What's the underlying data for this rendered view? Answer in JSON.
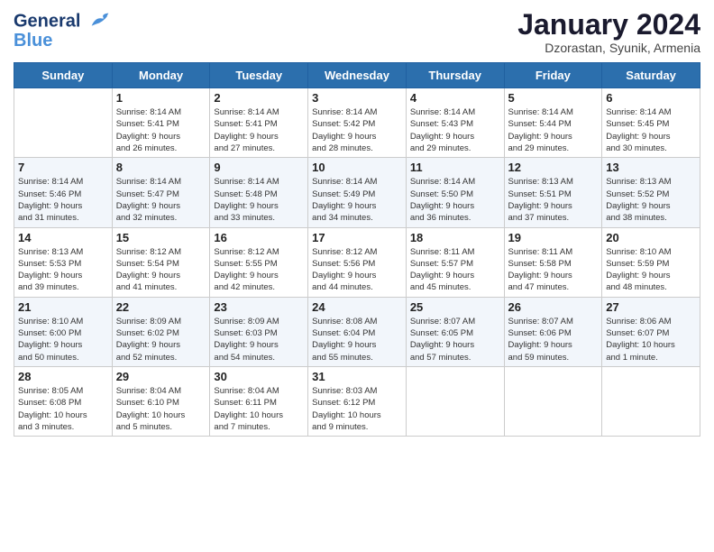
{
  "header": {
    "logo_line1": "General",
    "logo_line2": "Blue",
    "month_year": "January 2024",
    "location": "Dzorastan, Syunik, Armenia"
  },
  "days_of_week": [
    "Sunday",
    "Monday",
    "Tuesday",
    "Wednesday",
    "Thursday",
    "Friday",
    "Saturday"
  ],
  "weeks": [
    [
      {
        "day": "",
        "content": ""
      },
      {
        "day": "1",
        "content": "Sunrise: 8:14 AM\nSunset: 5:41 PM\nDaylight: 9 hours\nand 26 minutes."
      },
      {
        "day": "2",
        "content": "Sunrise: 8:14 AM\nSunset: 5:41 PM\nDaylight: 9 hours\nand 27 minutes."
      },
      {
        "day": "3",
        "content": "Sunrise: 8:14 AM\nSunset: 5:42 PM\nDaylight: 9 hours\nand 28 minutes."
      },
      {
        "day": "4",
        "content": "Sunrise: 8:14 AM\nSunset: 5:43 PM\nDaylight: 9 hours\nand 29 minutes."
      },
      {
        "day": "5",
        "content": "Sunrise: 8:14 AM\nSunset: 5:44 PM\nDaylight: 9 hours\nand 29 minutes."
      },
      {
        "day": "6",
        "content": "Sunrise: 8:14 AM\nSunset: 5:45 PM\nDaylight: 9 hours\nand 30 minutes."
      }
    ],
    [
      {
        "day": "7",
        "content": "Sunrise: 8:14 AM\nSunset: 5:46 PM\nDaylight: 9 hours\nand 31 minutes."
      },
      {
        "day": "8",
        "content": "Sunrise: 8:14 AM\nSunset: 5:47 PM\nDaylight: 9 hours\nand 32 minutes."
      },
      {
        "day": "9",
        "content": "Sunrise: 8:14 AM\nSunset: 5:48 PM\nDaylight: 9 hours\nand 33 minutes."
      },
      {
        "day": "10",
        "content": "Sunrise: 8:14 AM\nSunset: 5:49 PM\nDaylight: 9 hours\nand 34 minutes."
      },
      {
        "day": "11",
        "content": "Sunrise: 8:14 AM\nSunset: 5:50 PM\nDaylight: 9 hours\nand 36 minutes."
      },
      {
        "day": "12",
        "content": "Sunrise: 8:13 AM\nSunset: 5:51 PM\nDaylight: 9 hours\nand 37 minutes."
      },
      {
        "day": "13",
        "content": "Sunrise: 8:13 AM\nSunset: 5:52 PM\nDaylight: 9 hours\nand 38 minutes."
      }
    ],
    [
      {
        "day": "14",
        "content": "Sunrise: 8:13 AM\nSunset: 5:53 PM\nDaylight: 9 hours\nand 39 minutes."
      },
      {
        "day": "15",
        "content": "Sunrise: 8:12 AM\nSunset: 5:54 PM\nDaylight: 9 hours\nand 41 minutes."
      },
      {
        "day": "16",
        "content": "Sunrise: 8:12 AM\nSunset: 5:55 PM\nDaylight: 9 hours\nand 42 minutes."
      },
      {
        "day": "17",
        "content": "Sunrise: 8:12 AM\nSunset: 5:56 PM\nDaylight: 9 hours\nand 44 minutes."
      },
      {
        "day": "18",
        "content": "Sunrise: 8:11 AM\nSunset: 5:57 PM\nDaylight: 9 hours\nand 45 minutes."
      },
      {
        "day": "19",
        "content": "Sunrise: 8:11 AM\nSunset: 5:58 PM\nDaylight: 9 hours\nand 47 minutes."
      },
      {
        "day": "20",
        "content": "Sunrise: 8:10 AM\nSunset: 5:59 PM\nDaylight: 9 hours\nand 48 minutes."
      }
    ],
    [
      {
        "day": "21",
        "content": "Sunrise: 8:10 AM\nSunset: 6:00 PM\nDaylight: 9 hours\nand 50 minutes."
      },
      {
        "day": "22",
        "content": "Sunrise: 8:09 AM\nSunset: 6:02 PM\nDaylight: 9 hours\nand 52 minutes."
      },
      {
        "day": "23",
        "content": "Sunrise: 8:09 AM\nSunset: 6:03 PM\nDaylight: 9 hours\nand 54 minutes."
      },
      {
        "day": "24",
        "content": "Sunrise: 8:08 AM\nSunset: 6:04 PM\nDaylight: 9 hours\nand 55 minutes."
      },
      {
        "day": "25",
        "content": "Sunrise: 8:07 AM\nSunset: 6:05 PM\nDaylight: 9 hours\nand 57 minutes."
      },
      {
        "day": "26",
        "content": "Sunrise: 8:07 AM\nSunset: 6:06 PM\nDaylight: 9 hours\nand 59 minutes."
      },
      {
        "day": "27",
        "content": "Sunrise: 8:06 AM\nSunset: 6:07 PM\nDaylight: 10 hours\nand 1 minute."
      }
    ],
    [
      {
        "day": "28",
        "content": "Sunrise: 8:05 AM\nSunset: 6:08 PM\nDaylight: 10 hours\nand 3 minutes."
      },
      {
        "day": "29",
        "content": "Sunrise: 8:04 AM\nSunset: 6:10 PM\nDaylight: 10 hours\nand 5 minutes."
      },
      {
        "day": "30",
        "content": "Sunrise: 8:04 AM\nSunset: 6:11 PM\nDaylight: 10 hours\nand 7 minutes."
      },
      {
        "day": "31",
        "content": "Sunrise: 8:03 AM\nSunset: 6:12 PM\nDaylight: 10 hours\nand 9 minutes."
      },
      {
        "day": "",
        "content": ""
      },
      {
        "day": "",
        "content": ""
      },
      {
        "day": "",
        "content": ""
      }
    ]
  ]
}
